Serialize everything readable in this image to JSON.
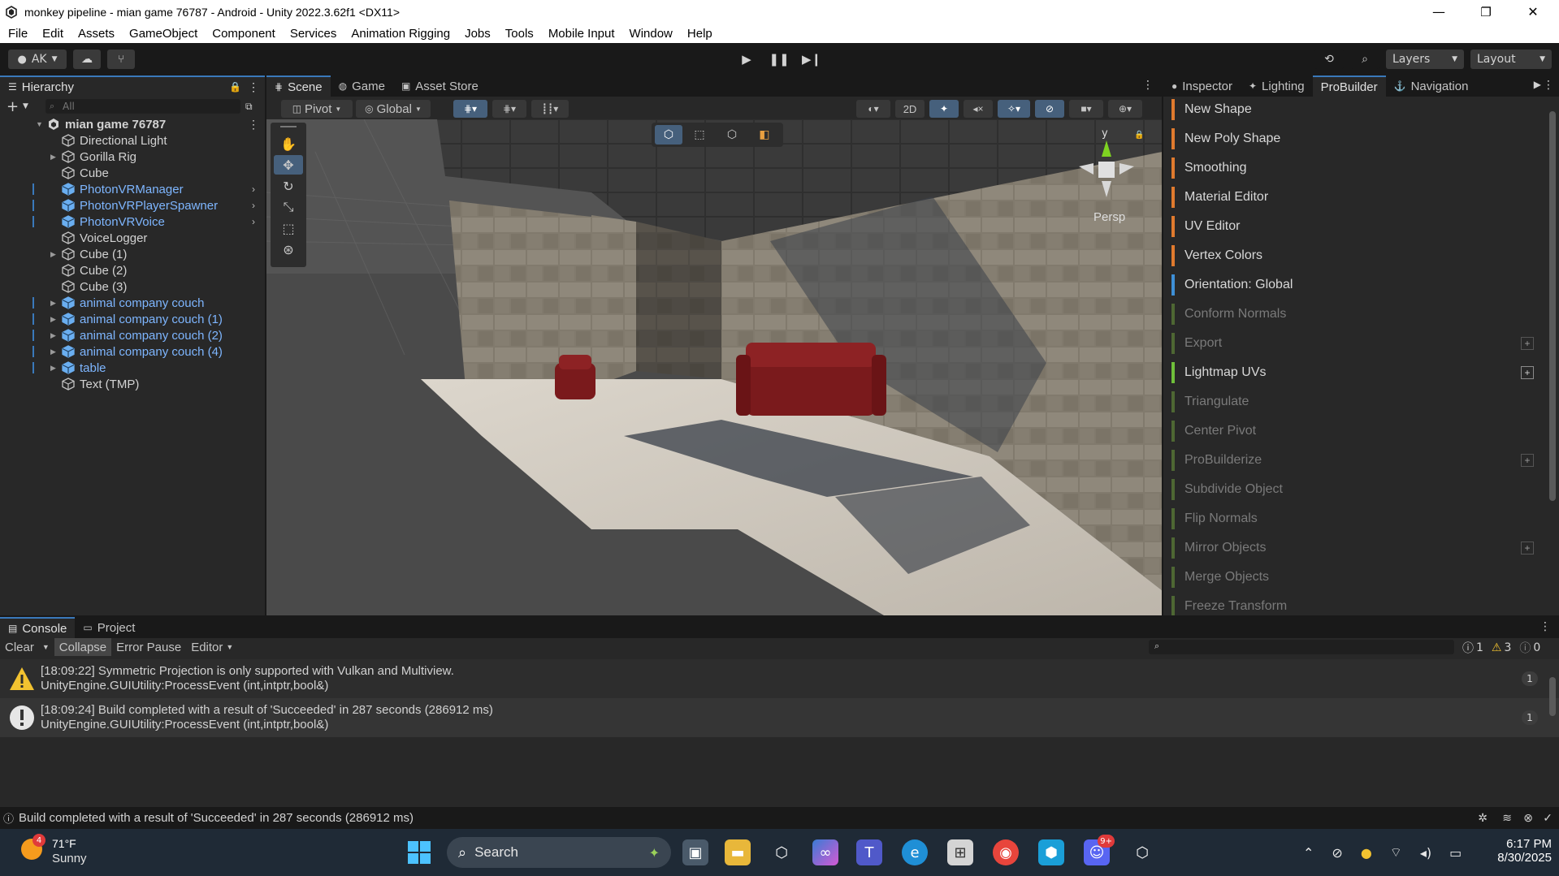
{
  "window": {
    "title": "monkey pipeline - mian game 76787 - Android - Unity 2022.3.62f1 <DX11>",
    "minimize": "—",
    "maximize": "❐",
    "close": "✕"
  },
  "menu": [
    "File",
    "Edit",
    "Assets",
    "GameObject",
    "Component",
    "Services",
    "Animation Rigging",
    "Jobs",
    "Tools",
    "Mobile Input",
    "Window",
    "Help"
  ],
  "toolbar": {
    "account": "AK",
    "layers": "Layers",
    "layout": "Layout"
  },
  "hierarchy": {
    "tab": "Hierarchy",
    "search_placeholder": "All",
    "scene": "mian game 76787",
    "items": [
      {
        "label": "Directional Light",
        "prefab": false,
        "expandable": false
      },
      {
        "label": "Gorilla Rig",
        "prefab": false,
        "expandable": true
      },
      {
        "label": "Cube",
        "prefab": false,
        "expandable": false
      },
      {
        "label": "PhotonVRManager",
        "prefab": true,
        "expandable": false
      },
      {
        "label": "PhotonVRPlayerSpawner",
        "prefab": true,
        "expandable": false
      },
      {
        "label": "PhotonVRVoice",
        "prefab": true,
        "expandable": false
      },
      {
        "label": "VoiceLogger",
        "prefab": false,
        "expandable": false
      },
      {
        "label": "Cube (1)",
        "prefab": false,
        "expandable": true
      },
      {
        "label": "Cube (2)",
        "prefab": false,
        "expandable": false
      },
      {
        "label": "Cube (3)",
        "prefab": false,
        "expandable": false
      },
      {
        "label": "animal company couch",
        "prefab": true,
        "expandable": true
      },
      {
        "label": "animal company couch (1)",
        "prefab": true,
        "expandable": true
      },
      {
        "label": "animal company couch (2)",
        "prefab": true,
        "expandable": true
      },
      {
        "label": "animal company couch (4)",
        "prefab": true,
        "expandable": true
      },
      {
        "label": "table",
        "prefab": true,
        "expandable": true
      },
      {
        "label": "Text (TMP)",
        "prefab": false,
        "expandable": false
      }
    ]
  },
  "scene_view": {
    "tabs": [
      "Scene",
      "Game",
      "Asset Store"
    ],
    "pivot": "Pivot",
    "global": "Global",
    "mode_2d": "2D",
    "gizmo_y": "y",
    "persp": "Persp"
  },
  "inspector": {
    "tabs": [
      "Inspector",
      "Lighting",
      "ProBuilder",
      "Navigation"
    ],
    "probuilder_items": [
      {
        "label": "New Shape",
        "enabled": true,
        "color": "#e07a2e",
        "plus": false
      },
      {
        "label": "New Poly Shape",
        "enabled": true,
        "color": "#e07a2e",
        "plus": false
      },
      {
        "label": "Smoothing",
        "enabled": true,
        "color": "#e07a2e",
        "plus": false
      },
      {
        "label": "Material Editor",
        "enabled": true,
        "color": "#e07a2e",
        "plus": false
      },
      {
        "label": "UV Editor",
        "enabled": true,
        "color": "#e07a2e",
        "plus": false
      },
      {
        "label": "Vertex Colors",
        "enabled": true,
        "color": "#e07a2e",
        "plus": false
      },
      {
        "label": "Orientation: Global",
        "enabled": true,
        "color": "#3e8fd6",
        "plus": false
      },
      {
        "label": "Conform Normals",
        "enabled": false,
        "color": "#6d9a3c",
        "plus": false
      },
      {
        "label": "Export",
        "enabled": false,
        "color": "#6d9a3c",
        "plus": true
      },
      {
        "label": "Lightmap UVs",
        "enabled": true,
        "color": "#6fbf3a",
        "plus": true
      },
      {
        "label": "Triangulate",
        "enabled": false,
        "color": "#6d9a3c",
        "plus": false
      },
      {
        "label": "Center Pivot",
        "enabled": false,
        "color": "#6d9a3c",
        "plus": false
      },
      {
        "label": "ProBuilderize",
        "enabled": false,
        "color": "#6d9a3c",
        "plus": true
      },
      {
        "label": "Subdivide Object",
        "enabled": false,
        "color": "#6d9a3c",
        "plus": false
      },
      {
        "label": "Flip Normals",
        "enabled": false,
        "color": "#6d9a3c",
        "plus": false
      },
      {
        "label": "Mirror Objects",
        "enabled": false,
        "color": "#6d9a3c",
        "plus": true
      },
      {
        "label": "Merge Objects",
        "enabled": false,
        "color": "#6d9a3c",
        "plus": false
      },
      {
        "label": "Freeze Transform",
        "enabled": false,
        "color": "#6d9a3c",
        "plus": false
      }
    ]
  },
  "console": {
    "tabs": [
      "Console",
      "Project"
    ],
    "clear": "Clear",
    "collapse": "Collapse",
    "error_pause": "Error Pause",
    "editor": "Editor",
    "info_count": "1",
    "warn_count": "3",
    "error_count": "0",
    "logs": [
      {
        "type": "warning",
        "line1": "[18:09:22] Symmetric Projection is only supported with Vulkan and Multiview.",
        "line2": "UnityEngine.GUIUtility:ProcessEvent (int,intptr,bool&)",
        "count": "1"
      },
      {
        "type": "info",
        "line1": "[18:09:24] Build completed with a result of 'Succeeded' in 287 seconds (286912 ms)",
        "line2": "UnityEngine.GUIUtility:ProcessEvent (int,intptr,bool&)",
        "count": "1"
      }
    ]
  },
  "status": {
    "message": "Build completed with a result of 'Succeeded' in 287 seconds (286912 ms)"
  },
  "taskbar": {
    "weather_temp": "71°F",
    "weather_desc": "Sunny",
    "weather_badge": "4",
    "search": "Search",
    "discord_badge": "9+",
    "time": "6:17 PM",
    "date": "8/30/2025"
  }
}
